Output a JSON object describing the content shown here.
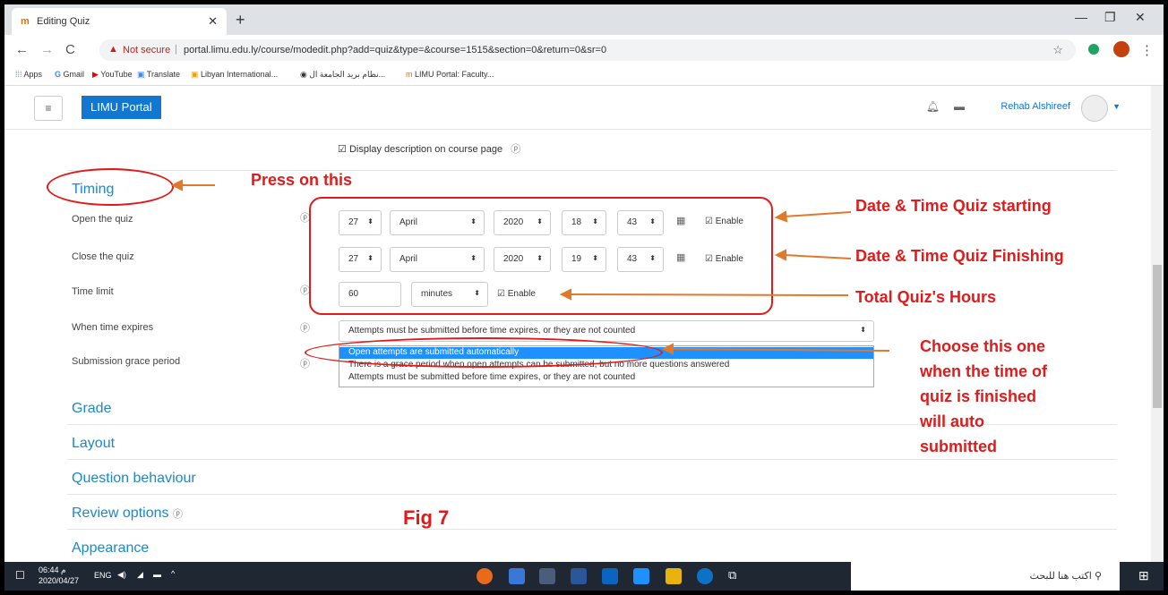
{
  "browser": {
    "tab_title": "Editing Quiz",
    "tab_icon": "moodle-icon",
    "security_label": "Not secure",
    "url": "portal.limu.edu.ly/course/modedit.php?add=quiz&type=&course=1515&section=0&return=0&sr=0",
    "bookmarks": [
      "Apps",
      "Gmail",
      "YouTube",
      "Translate",
      "Libyan International...",
      "نظام بريد الجامعة ال...",
      "LIMU Portal: Faculty..."
    ]
  },
  "navbar": {
    "brand": "LIMU Portal",
    "user": "Rehab Alshireef"
  },
  "form": {
    "display_description": "Display description on course page",
    "timing_header": "Timing",
    "open_label": "Open the quiz",
    "close_label": "Close the quiz",
    "time_limit_label": "Time limit",
    "when_expires_label": "When time expires",
    "grace_label": "Submission grace period",
    "open": {
      "day": "27",
      "month": "April",
      "year": "2020",
      "hour": "18",
      "minute": "43",
      "enable": "Enable"
    },
    "close": {
      "day": "27",
      "month": "April",
      "year": "2020",
      "hour": "19",
      "minute": "43",
      "enable": "Enable"
    },
    "time_limit": {
      "value": "60",
      "unit": "minutes",
      "enable": "Enable"
    },
    "when_expires_value": "Attempts must be submitted before time expires, or they are not counted",
    "options": [
      "Open attempts are submitted automatically",
      "There is a grace period when open attempts can be submitted, but no more questions answered",
      "Attempts must be submitted before time expires, or they are not counted"
    ],
    "sections": [
      "Grade",
      "Layout",
      "Question behaviour",
      "Review options",
      "Appearance"
    ]
  },
  "annotations": {
    "press": "Press on this",
    "start": "Date & Time Quiz starting",
    "finish": "Date & Time Quiz Finishing",
    "total": "Total Quiz's Hours",
    "choose": [
      "Choose this one",
      "when the time of",
      "quiz is finished",
      "will auto",
      "submitted"
    ],
    "fig": "Fig 7",
    "color": "#e01b1b",
    "arrow_color": "#e07a2a"
  },
  "taskbar": {
    "time": "م 06:44",
    "date": "2020/04/27",
    "lang": "ENG",
    "search_placeholder": "اكتب هنا للبحث"
  }
}
